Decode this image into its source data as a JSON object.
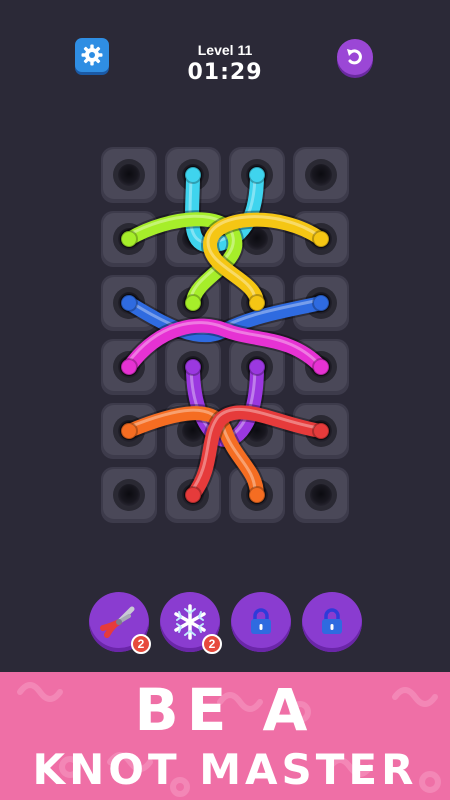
{
  "hud": {
    "level_label": "Level 11",
    "timer": "01:29",
    "settings_icon": "gear-icon",
    "undo_icon": "undo-icon"
  },
  "board": {
    "rows": 6,
    "cols": 4,
    "ropes": [
      {
        "color": "#3fd4ee",
        "name": "cyan-rope"
      },
      {
        "color": "#a6ee2a",
        "name": "lime-rope"
      },
      {
        "color": "#f5c614",
        "name": "yellow-rope"
      },
      {
        "color": "#2f6be0",
        "name": "blue-rope"
      },
      {
        "color": "#e632d3",
        "name": "magenta-rope"
      },
      {
        "color": "#9b38e0",
        "name": "purple-rope"
      },
      {
        "color": "#f56d22",
        "name": "orange-rope"
      },
      {
        "color": "#e63b3b",
        "name": "red-rope"
      }
    ]
  },
  "tools": [
    {
      "name": "pliers-tool",
      "icon": "pliers-icon",
      "count": "2"
    },
    {
      "name": "freeze-tool",
      "icon": "snowflake-icon",
      "count": "2"
    },
    {
      "name": "locked-tool-1",
      "icon": "lock-icon"
    },
    {
      "name": "locked-tool-2",
      "icon": "lock-icon"
    }
  ],
  "banner": {
    "line1": "BE A",
    "line2": "KNOT MASTER",
    "color": "#ef6fa6"
  }
}
